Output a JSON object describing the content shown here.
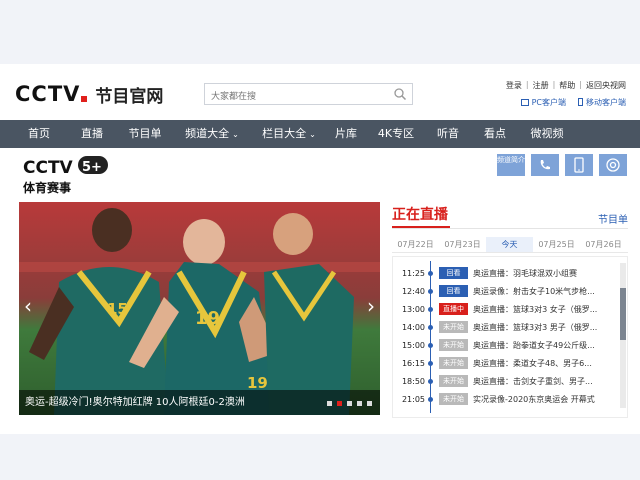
{
  "header": {
    "logo_text": "CCTV",
    "logo_sub": "节目官网",
    "search_placeholder": "大家都在搜",
    "top_links": [
      "登录",
      "注册",
      "帮助",
      "返回央视网"
    ],
    "client_links": [
      "PC客户端",
      "移动客户端"
    ]
  },
  "nav": {
    "items": [
      {
        "label": "首页",
        "dropdown": false
      },
      {
        "label": "直播",
        "dropdown": false
      },
      {
        "label": "节目单",
        "dropdown": false
      },
      {
        "label": "频道大全",
        "dropdown": true
      },
      {
        "label": "栏目大全",
        "dropdown": true
      },
      {
        "label": "片库",
        "dropdown": false
      },
      {
        "label": "4K专区",
        "dropdown": false
      },
      {
        "label": "听音",
        "dropdown": false
      },
      {
        "label": "看点",
        "dropdown": false
      },
      {
        "label": "微视频",
        "dropdown": false
      }
    ]
  },
  "channel": {
    "logo_text": "CCTV",
    "logo_num": "5+",
    "logo_name": "体育赛事",
    "icon_buttons": [
      {
        "label": "频道简介",
        "icon": "info-icon"
      },
      {
        "label": "",
        "icon": "phone-icon"
      },
      {
        "label": "",
        "icon": "mobile-icon"
      },
      {
        "label": "",
        "icon": "target-icon"
      }
    ]
  },
  "hero": {
    "caption": "奥运-超级冷门!奥尔特加红牌 10人阿根廷0-2澳洲",
    "dots_total": 5,
    "active_dot": 1,
    "jersey_numbers": [
      "15",
      "19",
      "19"
    ]
  },
  "live": {
    "title": "正在直播",
    "schedule_link": "节目单",
    "dates": [
      "07月22日",
      "07月23日",
      "今天",
      "07月25日",
      "07月26日"
    ],
    "active_date_index": 2,
    "badge_colors": {
      "回看": "#2b5fb3",
      "直播中": "#d8201c",
      "未开始": "#b9b9b9"
    },
    "programs": [
      {
        "time": "11:25",
        "status": "回看",
        "title": "奥运直播：羽毛球混双小组赛"
      },
      {
        "time": "12:40",
        "status": "回看",
        "title": "奥运录像：射击女子10米气步枪..."
      },
      {
        "time": "13:00",
        "status": "直播中",
        "title": "奥运直播：篮球3对3 女子（俄罗..."
      },
      {
        "time": "14:00",
        "status": "未开始",
        "title": "奥运直播：篮球3对3 男子（俄罗..."
      },
      {
        "time": "15:00",
        "status": "未开始",
        "title": "奥运直播：跆拳道女子49公斤级..."
      },
      {
        "time": "16:15",
        "status": "未开始",
        "title": "奥运直播：柔道女子48、男子6..."
      },
      {
        "time": "18:50",
        "status": "未开始",
        "title": "奥运直播：击剑女子重剑、男子..."
      },
      {
        "time": "21:05",
        "status": "未开始",
        "title": "实况录像-2020东京奥运会 开幕式"
      }
    ]
  }
}
